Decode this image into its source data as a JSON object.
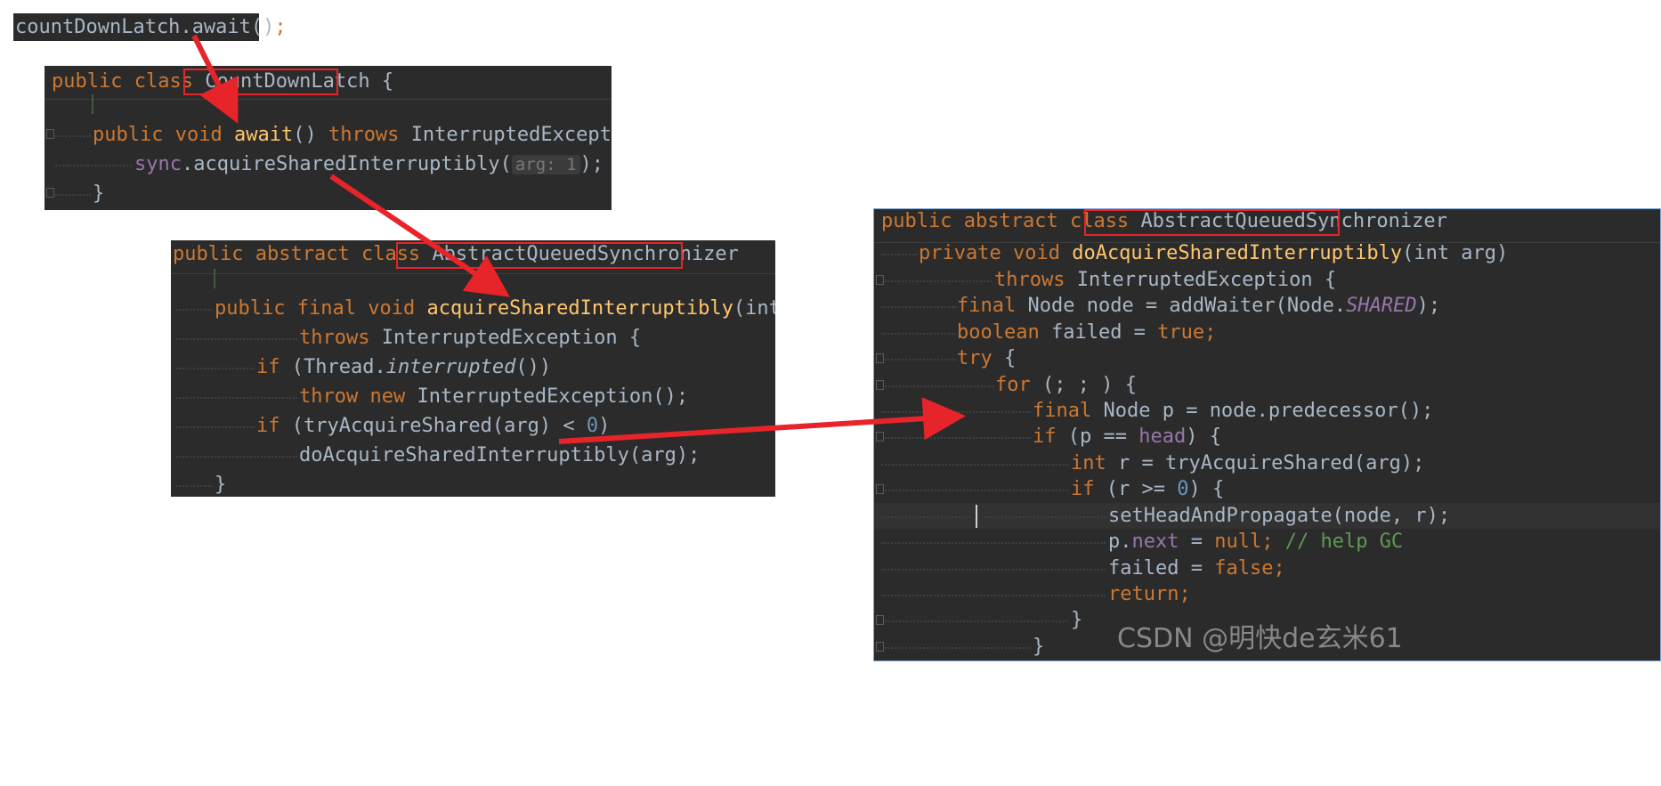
{
  "snippet": {
    "obj": "countDownLatch",
    "dot": ".",
    "method": "await",
    "tail": "()",
    "semi": ";"
  },
  "panel1": {
    "kw_public": "public",
    "kw_class": "class",
    "class_name": "CountDownLatch",
    "open_brace": "{",
    "kw_void": "void",
    "method": "await",
    "parens": "()",
    "kw_throws": "throws",
    "exception": "InterruptedException",
    "field_sync": "sync",
    "call": ".acquireSharedInterruptibly(",
    "hint_label": "arg:",
    "hint_value": "1",
    "call_end": ");",
    "close_brace": "}"
  },
  "panel2": {
    "kw_public": "public",
    "kw_abstract": "abstract",
    "kw_class": "class",
    "class_name": "AbstractQueuedSynchronizer",
    "kw_final": "final",
    "kw_void": "void",
    "method": "acquireSharedInterruptibly",
    "kw_int": "int",
    "param": "(int arg)",
    "kw_throws": "throws",
    "exception": "InterruptedException {",
    "kw_if": "if",
    "thread_check": "(Thread.",
    "interrupted": "interrupted",
    "thread_end": "())",
    "kw_throw": "throw",
    "kw_new": "new",
    "new_exc": "InterruptedException();",
    "try_acquire": "(tryAcquireShared(arg) < ",
    "zero": "0",
    "try_end": ")",
    "do_acquire": "doAcquireSharedInterruptibly(arg);",
    "close_brace": "}"
  },
  "panel3": {
    "kw_public": "public",
    "kw_abstract": "abstract",
    "kw_class": "class",
    "class_name": "AbstractQueuedSynchronizer",
    "kw_private": "private",
    "kw_void": "void",
    "method": "doAcquireSharedInterruptibly",
    "param": "(int arg)",
    "kw_throws": "throws",
    "exception": "InterruptedException {",
    "kw_final": "final",
    "node_decl": "Node node = addWaiter(Node.",
    "shared": "SHARED",
    "node_end": ");",
    "kw_boolean": "boolean",
    "failed_decl": "failed = ",
    "kw_true": "true",
    "kw_try": "try",
    "kw_for": "for",
    "for_loop": "(; ; ) {",
    "pred_decl": "Node p = node.predecessor();",
    "kw_if": "if",
    "if_head_a": "(p == ",
    "head": "head",
    "if_head_b": ") {",
    "kw_int": "int",
    "r_decl": "r = tryAcquireShared(arg);",
    "if_r_a": "(r >= ",
    "zero": "0",
    "if_r_b": ") {",
    "set_head": "setHeadAndPropagate(node, r);",
    "p_dot": "p.",
    "next": "next",
    "eq": " = ",
    "kw_null": "null",
    "comment": "// help GC",
    "failed_assign": "failed = ",
    "kw_false": "false",
    "kw_return": "return",
    "semi": ";",
    "close_brace": "}",
    "open_brace": " {"
  },
  "watermark": "CSDN @明快de玄米61",
  "colors": {
    "editor_bg": "#2b2b2b",
    "keyword": "#cc7832",
    "method": "#ffc66d",
    "text": "#a9b7c6",
    "number": "#6897bb",
    "field": "#9876aa",
    "comment": "#629755",
    "annotation_red": "#e8242b"
  }
}
